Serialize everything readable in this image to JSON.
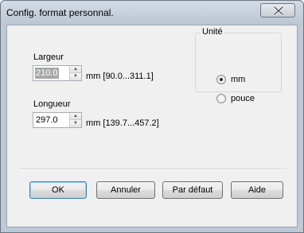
{
  "window": {
    "title": "Config. format personnal."
  },
  "width_field": {
    "label": "Largeur",
    "value": "210.0",
    "range": "mm [90.0...311.1]"
  },
  "length_field": {
    "label": "Longueur",
    "value": "297.0",
    "range": "mm [139.7...457.2]"
  },
  "unit_group": {
    "legend": "Unité",
    "options": [
      {
        "label": "mm",
        "selected": true
      },
      {
        "label": "pouce",
        "selected": false
      }
    ]
  },
  "buttons": {
    "ok": "OK",
    "cancel": "Annuler",
    "default": "Par défaut",
    "help": "Aide"
  },
  "icons": {
    "close": "close-icon",
    "spin_up": "spin-up-arrow-icon",
    "spin_down": "spin-down-arrow-icon"
  }
}
